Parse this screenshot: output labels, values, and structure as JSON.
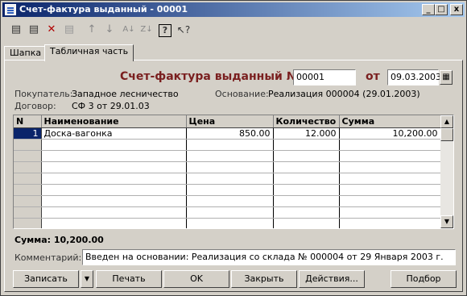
{
  "window": {
    "title": "Счет-фактура выданный - 00001",
    "controls": [
      "_",
      "□",
      "x"
    ]
  },
  "toolbar": {
    "icons": [
      "new-row-icon",
      "copy-row-icon",
      "delete-row-icon",
      "disabled-row-icon",
      "move-up-icon",
      "move-down-icon",
      "sort-asc-icon",
      "sort-desc-icon",
      "help-icon",
      "context-help-icon"
    ]
  },
  "tabs": [
    {
      "label": "Шапка",
      "active": false
    },
    {
      "label": "Табличная часть",
      "active": true
    }
  ],
  "header": {
    "doc_title": "Счет-фактура выданный №",
    "number": "00001",
    "date_label": "от",
    "date": "09.03.2003",
    "buyer_label": "Покупатель:",
    "buyer": "Западное лесничество",
    "basis_label": "Основание:",
    "basis": "Реализация 000004 (29.01.2003)",
    "contract_label": "Договор:",
    "contract": "СФ 3 от 29.01.03"
  },
  "table": {
    "columns": [
      "N",
      "Наименование",
      "Цена",
      "Количество",
      "Сумма"
    ],
    "rows": [
      {
        "n": "1",
        "name": "Доска-вагонка",
        "price": "850.00",
        "qty": "12.000",
        "sum": "10,200.00"
      }
    ]
  },
  "footer": {
    "total": "Сумма: 10,200.00",
    "comment_label": "Комментарий:",
    "comment": "Введен на основании: Реализация со склада № 000004 от 29 Января 2003 г."
  },
  "buttons": {
    "save": "Записать",
    "print": "Печать",
    "ok": "OK",
    "close": "Закрыть",
    "actions": "Действия...",
    "select": "Подбор"
  }
}
